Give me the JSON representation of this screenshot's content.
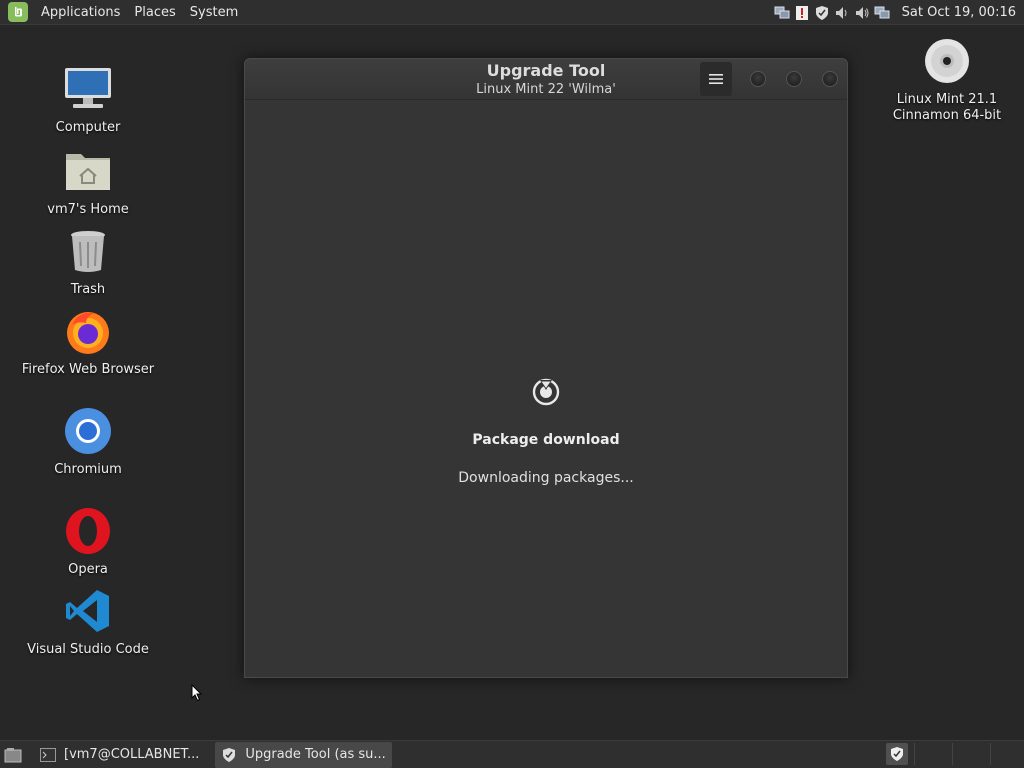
{
  "top_panel": {
    "menu": [
      "Applications",
      "Places",
      "System"
    ],
    "clock": "Sat Oct 19, 00:16",
    "tray_icons": [
      "network-icon",
      "update-warning-icon",
      "shield-icon",
      "volume-icon",
      "volume-icon-2",
      "network-wired-icon"
    ]
  },
  "desktop_icons": [
    {
      "name": "Computer",
      "icon": "computer-icon"
    },
    {
      "name": "vm7's Home",
      "icon": "home-folder-icon"
    },
    {
      "name": "Trash",
      "icon": "trash-icon"
    },
    {
      "name": "Firefox Web Browser",
      "icon": "firefox-icon"
    },
    {
      "name": "Chromium",
      "icon": "chromium-icon"
    },
    {
      "name": "Opera",
      "icon": "opera-icon"
    },
    {
      "name": "Visual Studio Code",
      "icon": "vscode-icon"
    }
  ],
  "disc": {
    "line1": "Linux Mint 21.1",
    "line2": "Cinnamon 64-bit"
  },
  "window": {
    "title": "Upgrade Tool",
    "subtitle": "Linux Mint 22 'Wilma'",
    "status_title": "Package download",
    "status_text": "Downloading packages..."
  },
  "taskbar": {
    "tasks": [
      {
        "label": "[vm7@COLLABNET...",
        "icon": "terminal-icon",
        "active": false
      },
      {
        "label": "Upgrade Tool (as su...",
        "icon": "shield-icon",
        "active": true
      }
    ]
  },
  "colors": {
    "accent": "#87bd5b",
    "desktop_bg": "#272727",
    "panel_bg": "#2f2f2f",
    "window_bg": "#353535"
  }
}
